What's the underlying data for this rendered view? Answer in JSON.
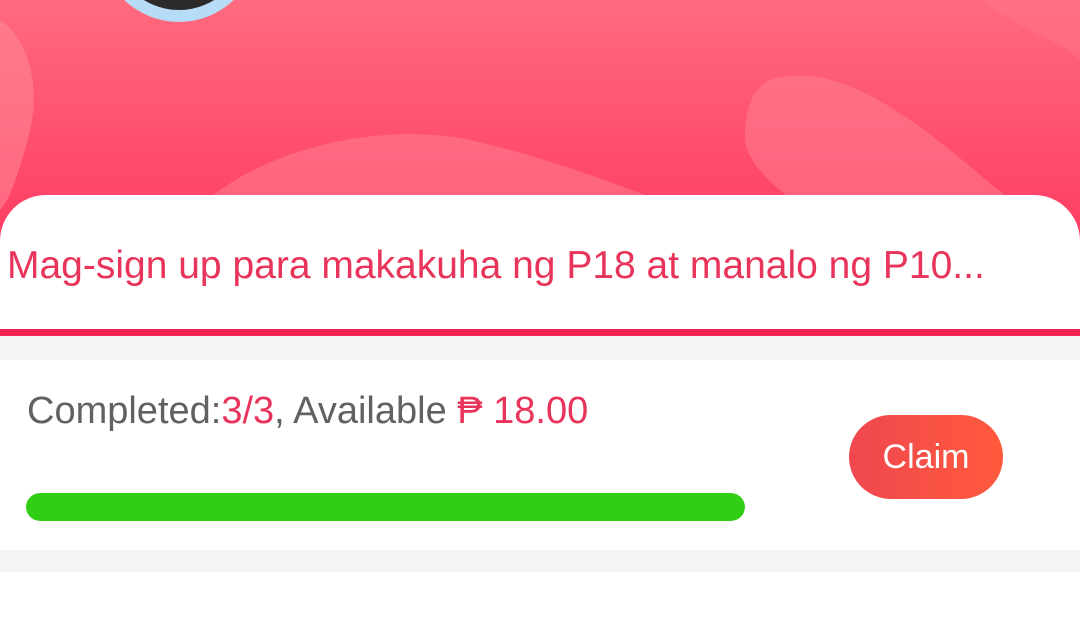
{
  "hero": {
    "avatar": "profile-avatar"
  },
  "banner": {
    "text": "Mag-sign up para makakuha ng P18 at manalo ng P10..."
  },
  "task": {
    "completed_label": "Completed:",
    "completed_value": "3/3",
    "available_label": ", Available ",
    "available_value": "₱ 18.00",
    "progress": 1.0,
    "claim_label": "Claim"
  },
  "colors": {
    "accent": "#e8335a",
    "progress": "#30cf14",
    "claim_button": "#f5503f",
    "hero": "#ff5170"
  }
}
